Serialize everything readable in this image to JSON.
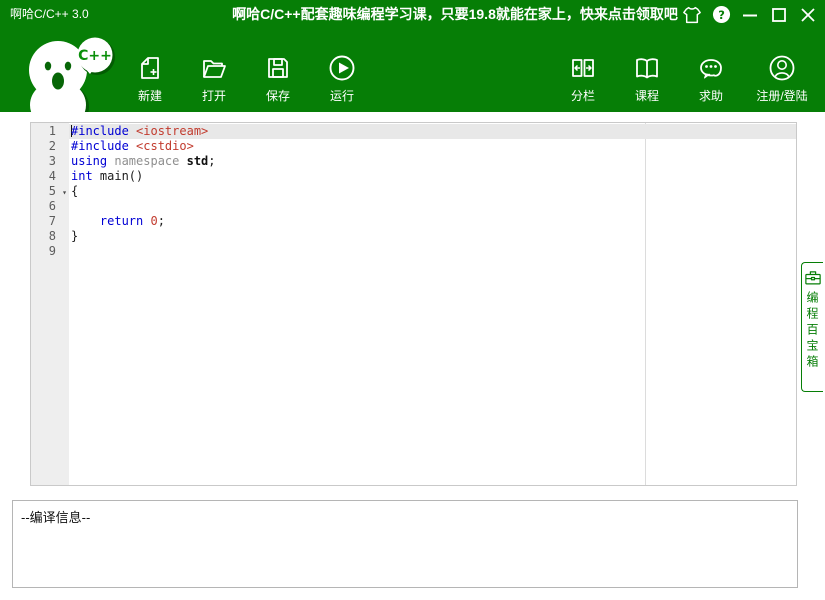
{
  "window": {
    "title": "啊哈C/C++ 3.0",
    "promo": "啊哈C/C++配套趣味编程学习课，只要19.8就能在家上，快来点击领取吧",
    "controls": [
      "skin",
      "help",
      "minimize",
      "maximize",
      "close"
    ]
  },
  "toolbar": {
    "mascot_bubble_text": "C++",
    "file_buttons": [
      {
        "label": "新建",
        "icon": "new-file-icon"
      },
      {
        "label": "打开",
        "icon": "open-folder-icon"
      },
      {
        "label": "保存",
        "icon": "save-icon"
      },
      {
        "label": "运行",
        "icon": "run-icon"
      }
    ],
    "right_buttons": [
      {
        "label": "分栏",
        "icon": "split-columns-icon"
      },
      {
        "label": "课程",
        "icon": "book-icon"
      },
      {
        "label": "求助",
        "icon": "chat-help-icon"
      },
      {
        "label": "注册/登陆",
        "icon": "user-login-icon"
      }
    ]
  },
  "editor": {
    "lines": [
      {
        "num": "1",
        "current": true,
        "caret": true,
        "tokens": [
          {
            "text": "#include ",
            "type": "kw"
          },
          {
            "text": "<iostream>",
            "type": "str"
          }
        ]
      },
      {
        "num": "2",
        "tokens": [
          {
            "text": "#include ",
            "type": "kw"
          },
          {
            "text": "<cstdio>",
            "type": "str"
          }
        ]
      },
      {
        "num": "3",
        "tokens": [
          {
            "text": "using ",
            "type": "kw"
          },
          {
            "text": "namespace ",
            "type": "ns"
          },
          {
            "text": "std",
            "type": "type"
          },
          {
            "text": ";",
            "type": "plain"
          }
        ]
      },
      {
        "num": "4",
        "tokens": [
          {
            "text": "int ",
            "type": "kw"
          },
          {
            "text": "main()",
            "type": "plain"
          }
        ]
      },
      {
        "num": "5",
        "fold": true,
        "tokens": [
          {
            "text": "{",
            "type": "plain"
          }
        ]
      },
      {
        "num": "6",
        "tokens": []
      },
      {
        "num": "7",
        "tokens": [
          {
            "text": "    ",
            "type": "plain"
          },
          {
            "text": "return ",
            "type": "kw"
          },
          {
            "text": "0",
            "type": "num"
          },
          {
            "text": ";",
            "type": "plain"
          }
        ]
      },
      {
        "num": "8",
        "tokens": [
          {
            "text": "}",
            "type": "plain"
          }
        ]
      },
      {
        "num": "9",
        "tokens": []
      }
    ]
  },
  "side_panel": {
    "label": "编程百宝箱"
  },
  "output_panel": {
    "message": "--编译信息--"
  },
  "colors": {
    "accent_green": "#067e06",
    "shadow_green": "#045c04",
    "keyword_blue": "#0000d4",
    "literal_red": "#c23b2e"
  }
}
